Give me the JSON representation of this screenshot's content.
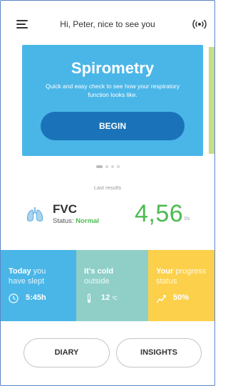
{
  "header": {
    "greeting": "Hi, Peter, nice to see you",
    "menu_icon": "hamburger-menu-icon",
    "device_icon": "signal-broadcast-icon"
  },
  "carousel": {
    "active_card": {
      "title": "Spirometry",
      "description": "Quick and easy check to see how your respiratory function looks like.",
      "button_label": "BEGIN",
      "color": "#4ab6e8",
      "button_color": "#1a73b8"
    },
    "next_card_color": "#c8dc8a",
    "page_count": 4,
    "active_page": 1
  },
  "results": {
    "section_label": "Last results",
    "metric": "FVC",
    "status_label": "Status:",
    "status_value": "Normal",
    "value": "4,56",
    "unit": "l/s",
    "icon": "lungs-icon",
    "accent_color": "#4cbb50"
  },
  "tiles": [
    {
      "bold": "Today",
      "rest_1": " you",
      "line_2": "have slept",
      "value": "5:45h",
      "unit": "",
      "icon": "clock-icon",
      "color": "#4ab6e8"
    },
    {
      "bold": "It's cold",
      "rest_1": "",
      "line_2": "outside",
      "value": "12",
      "unit": "ºC",
      "icon": "thermometer-icon",
      "color": "#8fcfc8"
    },
    {
      "bold": "Your",
      "rest_1": " progress",
      "line_2": "status",
      "value": "50%",
      "unit": "",
      "icon": "trend-chart-icon",
      "color": "#fcd04a"
    }
  ],
  "bottom_nav": {
    "diary_label": "DIARY",
    "insights_label": "INSIGHTS"
  }
}
